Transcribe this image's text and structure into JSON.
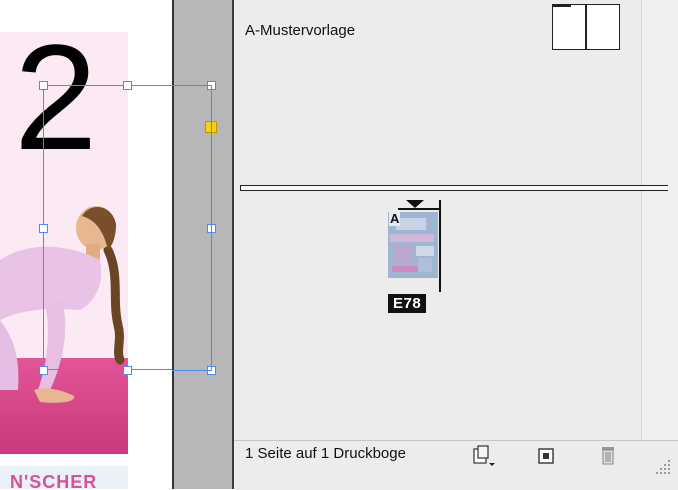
{
  "canvas": {
    "page_number": "2",
    "bottom_text": "N'SCHER"
  },
  "pages_panel": {
    "master": {
      "label": "A-Mustervorlage"
    },
    "page": {
      "master_prefix": "A",
      "label": "E78"
    },
    "footer": {
      "status": "1 Seite auf 1 Druckboge",
      "icons": [
        "edit-page-size-icon",
        "new-page-icon",
        "delete-page-icon",
        "resize-grip-icon"
      ]
    }
  },
  "colors": {
    "selection": "#4a8cf0",
    "handle_highlight": "#f4d21a",
    "page_background": "#fbeaf3",
    "mat": "#d94a8c",
    "panel_bg": "#ececec"
  }
}
